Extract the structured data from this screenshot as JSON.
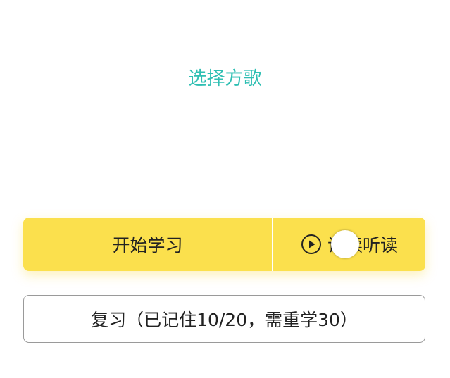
{
  "header": {
    "select_song_link": "选择方歌"
  },
  "actions": {
    "start_learning_label": "开始学习",
    "listen_label": "诵读听读"
  },
  "review": {
    "label": "复习（已记住10/20，需重学30）"
  },
  "colors": {
    "accent_teal": "#2fbfb3",
    "button_yellow": "#fbe04d",
    "text_dark": "#222222",
    "border_gray": "#9a9a9a"
  },
  "icons": {
    "listen_icon": "play-circle-icon"
  }
}
